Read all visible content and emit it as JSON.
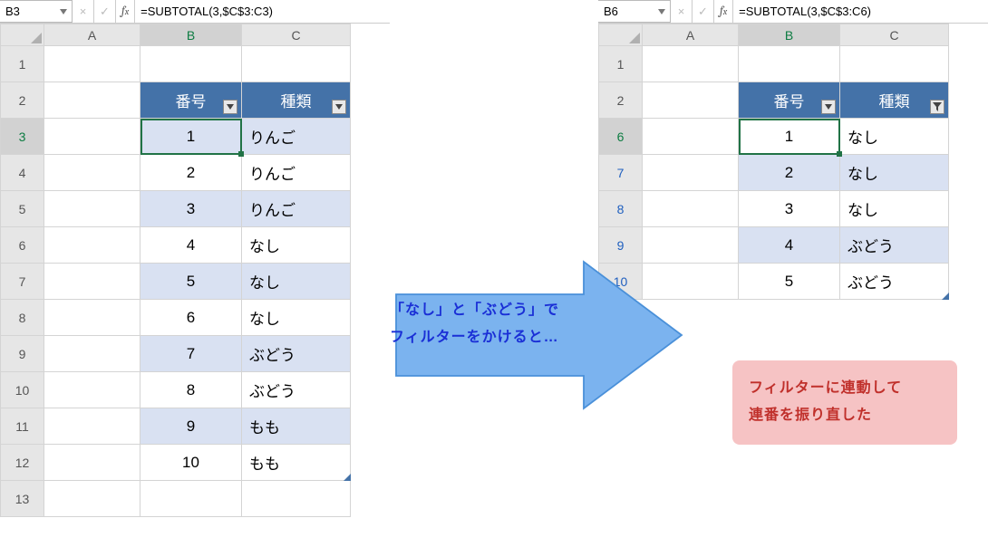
{
  "left": {
    "nameBox": "B3",
    "formula": "=SUBTOTAL(3,$C$3:C3)",
    "cols": [
      "A",
      "B",
      "C"
    ],
    "activeCol": "B",
    "activeRow": "3",
    "table": {
      "headers": {
        "num": "番号",
        "kind": "種類"
      },
      "rows": [
        {
          "r": "1"
        },
        {
          "r": "2",
          "num": "",
          "kind": "",
          "isHeader": true
        },
        {
          "r": "3",
          "num": "1",
          "kind": "りんご"
        },
        {
          "r": "4",
          "num": "2",
          "kind": "りんご"
        },
        {
          "r": "5",
          "num": "3",
          "kind": "りんご"
        },
        {
          "r": "6",
          "num": "4",
          "kind": "なし"
        },
        {
          "r": "7",
          "num": "5",
          "kind": "なし"
        },
        {
          "r": "8",
          "num": "6",
          "kind": "なし"
        },
        {
          "r": "9",
          "num": "7",
          "kind": "ぶどう"
        },
        {
          "r": "10",
          "num": "8",
          "kind": "ぶどう"
        },
        {
          "r": "11",
          "num": "9",
          "kind": "もも"
        },
        {
          "r": "12",
          "num": "10",
          "kind": "もも"
        },
        {
          "r": "13"
        }
      ]
    }
  },
  "right": {
    "nameBox": "B6",
    "formula": "=SUBTOTAL(3,$C$3:C6)",
    "cols": [
      "A",
      "B",
      "C"
    ],
    "activeCol": "B",
    "activeRow": "6",
    "table": {
      "headers": {
        "num": "番号",
        "kind": "種類"
      },
      "rows": [
        {
          "r": "1"
        },
        {
          "r": "2",
          "isHeader": true
        },
        {
          "r": "6",
          "num": "1",
          "kind": "なし"
        },
        {
          "r": "7",
          "num": "2",
          "kind": "なし"
        },
        {
          "r": "8",
          "num": "3",
          "kind": "なし"
        },
        {
          "r": "9",
          "num": "4",
          "kind": "ぶどう"
        },
        {
          "r": "10",
          "num": "5",
          "kind": "ぶどう"
        }
      ]
    }
  },
  "arrowText1": "「なし」と「ぶどう」で",
  "arrowText2": "フィルターをかけると…",
  "redText1": "フィルターに連動して",
  "redText2": "連番を振り直した"
}
